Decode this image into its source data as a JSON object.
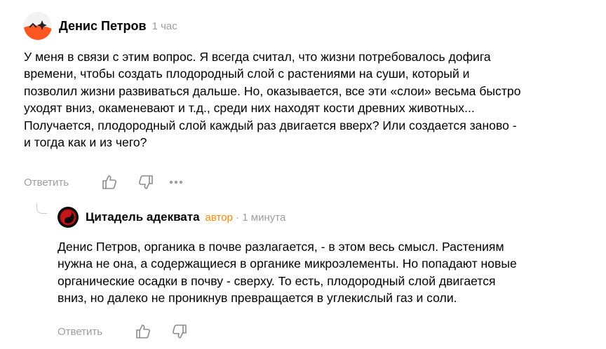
{
  "comment": {
    "author": "Денис Петров",
    "time": "1 час",
    "text": "У меня в связи с этим вопрос. Я всегда считал, что жизни потребовалось дофига\nвремени, чтобы создать плодородный слой с растениями на суши, который и\nпозволил жизни развиваться дальше. Но, оказывается, все эти «слои» весьма быстро\nуходят вниз, окаменевают и т.д., среди них находят кости древних животных...\nПолучается, плодородный слой каждый раз двигается вверх? Или создается заново -\nи тогда как и из чего?",
    "reply_label": "Ответить",
    "avatar_colors": {
      "top": "#f3f3f3",
      "bottom": "#ff5722"
    }
  },
  "reply": {
    "author": "Цитадель адеквата",
    "author_tag": "автор",
    "separator": "·",
    "time": "1 минута",
    "text": "Денис Петров, органика в почве разлагается, - в этом весь смысл. Растениям\nнужна не она, а содержащиеся в органике микроэлементы. Но попадают новые\nорганические осадки в почву - сверху. То есть, плодородный слой двигается\nвниз, но далеко не проникнув превращается в углекислый газ и соли.",
    "reply_label": "Ответить"
  },
  "colors": {
    "muted": "#9e9e9e",
    "accent": "#ff8a00",
    "text": "#000000"
  }
}
